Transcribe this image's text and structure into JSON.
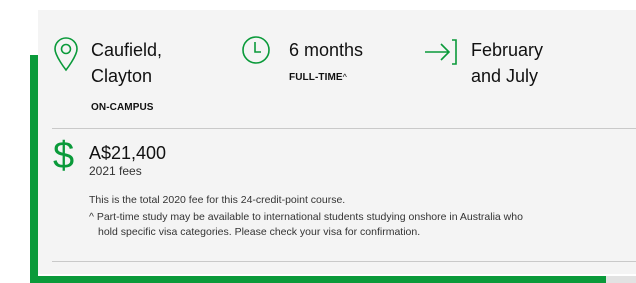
{
  "location": {
    "line1": "Caufield,",
    "line2": "Clayton",
    "mode": "ON-CAMPUS"
  },
  "duration": {
    "value": "6 months",
    "mode": "FULL-TIME",
    "footnote_mark": "^"
  },
  "intake": {
    "line1": "February",
    "line2": "and July"
  },
  "fees": {
    "currency_symbol": "$",
    "amount": "A$21,400",
    "year_label": "2021 fees",
    "note": "This is the total 2020 fee for this 24-credit-point course.",
    "footnote_line1": "^ Part-time study may be available to international students studying onshore in Australia who",
    "footnote_line2": "hold specific visa categories. Please check your visa for confirmation."
  },
  "colors": {
    "accent": "#0a9a3a",
    "card_bg": "#f4f4f4"
  }
}
